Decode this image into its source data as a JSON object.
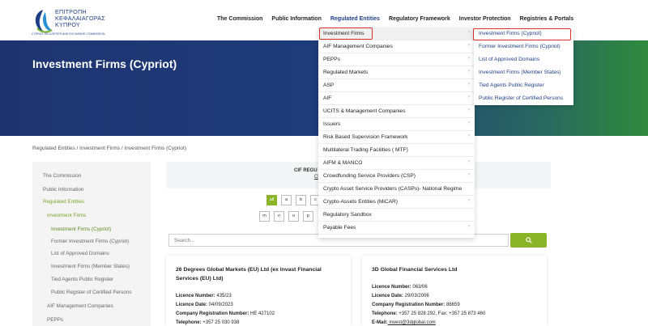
{
  "logo": {
    "line1": "ΕΠΙΤΡΟΠΗ",
    "line2": "ΚΕΦΑΛΑΙΑΓΟΡΑΣ",
    "line3": "ΚΥΠΡΟΥ",
    "sub": "CYPRUS SECURITIES AND EXCHANGE COMMISSION",
    "color": "#1e3f87"
  },
  "nav": {
    "items": [
      {
        "label": "The Commission"
      },
      {
        "label": "Public Information"
      },
      {
        "label": "Regulated Entities"
      },
      {
        "label": "Regulatory Framework"
      },
      {
        "label": "Investor Protection"
      },
      {
        "label": "Registries & Portals"
      }
    ]
  },
  "hero": {
    "title": "Investment Firms (Cypriot)"
  },
  "breadcrumb": "Regulated Entities / Investment Firms / Investment Firms (Cypriot)",
  "sidebar": {
    "items": [
      {
        "label": "The Commission"
      },
      {
        "label": "Public Information"
      },
      {
        "label": "Regulated Entities"
      },
      {
        "label": "Investment Firms"
      },
      {
        "label": "Investment Firms (Cypriot)"
      },
      {
        "label": "Former Investment Firms (Cypriot)"
      },
      {
        "label": "List of Approved Domains"
      },
      {
        "label": "Investment Firms (Member States)"
      },
      {
        "label": "Tied Agents Public Register"
      },
      {
        "label": "Public Register of Certified Persons"
      },
      {
        "label": "AIF Management Companies"
      },
      {
        "label": "PEPPs"
      }
    ]
  },
  "main": {
    "cif_title": "CIF REGU",
    "cif_link": "Cl",
    "letters_row1": [
      "all",
      "a",
      "b",
      "c"
    ],
    "letters_row2": [
      "m",
      "n",
      "o",
      "p"
    ],
    "search_placeholder": "Search...",
    "accent": "#8bb529"
  },
  "cards": [
    {
      "title": "26 Degrees Global Markets (EU) Ltd (ex Invast Financial Services (EU) Ltd)",
      "lines": [
        {
          "k": "Licence Number:",
          "v": " 435/23"
        },
        {
          "k": "Licence Date:",
          "v": " 04/09/2023"
        },
        {
          "k": "Company Registration Number:",
          "v": " HE 427102"
        },
        {
          "k": "Telephone:",
          "v": " +357 25 030 938"
        }
      ]
    },
    {
      "title": "3D Global Financial Services Ltd",
      "lines": [
        {
          "k": "Licence Number:",
          "v": " 063/06"
        },
        {
          "k": "Licence Date:",
          "v": " 29/03/2006"
        },
        {
          "k": "Company Registration Number:",
          "v": " 86659"
        },
        {
          "k": "Telephone:",
          "v": " +357 25 828 292, Fax: +357 25 873 460"
        },
        {
          "k": "E-Mail:",
          "v": " invest@3dglobal.com"
        }
      ]
    }
  ],
  "dropdown": {
    "items": [
      {
        "label": "Investment Firms"
      },
      {
        "label": "AIF Management Companies"
      },
      {
        "label": "PEPPs"
      },
      {
        "label": "Regulated Markets"
      },
      {
        "label": "ASP"
      },
      {
        "label": "AIF"
      },
      {
        "label": "UCITS & Management Companies"
      },
      {
        "label": "Issuers"
      },
      {
        "label": "Risk Based Supervision Framework"
      },
      {
        "label": "Multilateral Trading Facilities ( MTF)"
      },
      {
        "label": "AIFM & MANCO"
      },
      {
        "label": "Crowdfunding Service Providers (CSP)"
      },
      {
        "label": "Crypto Asset Service Providers (CASPs)- National Regime"
      },
      {
        "label": "Crypto-Assets Entities (MiCAR)"
      },
      {
        "label": "Regulatory Sandbox"
      },
      {
        "label": "Payable Fees"
      }
    ]
  },
  "submenu": {
    "items": [
      {
        "label": "Investment Firms (Cypriot)"
      },
      {
        "label": "Former Investment Firms (Cypriot)"
      },
      {
        "label": "List of Approved Domains"
      },
      {
        "label": "Investment Firms (Member States)"
      },
      {
        "label": "Tied Agents Public Register"
      },
      {
        "label": "Public Register of Certified Persons"
      }
    ]
  },
  "highlight_color": "#d9302a"
}
